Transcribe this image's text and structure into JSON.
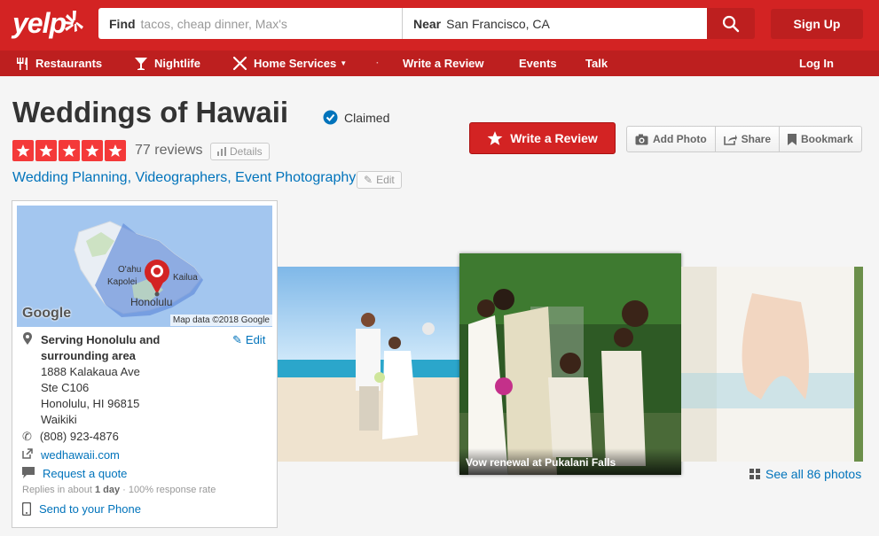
{
  "header": {
    "logo_text": "yelp",
    "find_label": "Find",
    "find_placeholder": "tacos, cheap dinner, Max's",
    "near_label": "Near",
    "near_value": "San Francisco, CA",
    "signup_label": "Sign Up",
    "brand_color": "#d32323"
  },
  "nav": {
    "items": [
      {
        "label": "Restaurants",
        "icon": "fork-knife-icon"
      },
      {
        "label": "Nightlife",
        "icon": "cocktail-icon"
      },
      {
        "label": "Home Services",
        "icon": "tools-icon"
      },
      {
        "label": "Write a Review"
      },
      {
        "label": "Events"
      },
      {
        "label": "Talk"
      }
    ],
    "login_label": "Log In"
  },
  "business": {
    "name": "Weddings of Hawaii",
    "claimed_label": "Claimed",
    "rating": 5,
    "review_count": "77 reviews",
    "details_label": "Details",
    "categories": [
      "Wedding Planning",
      "Videographers",
      "Event Photography"
    ],
    "edit_label": "Edit"
  },
  "actions": {
    "write_review": "Write a Review",
    "add_photo": "Add Photo",
    "share": "Share",
    "bookmark": "Bookmark"
  },
  "map": {
    "labels": [
      "O'ahu",
      "Kapolei",
      "Kailua",
      "Honolulu"
    ],
    "attribution": "Map data ©2018 Google",
    "google": "Google"
  },
  "info": {
    "service_area": "Serving Honolulu and surrounding area",
    "edit": "Edit",
    "address": [
      "1888 Kalakaua Ave",
      "Ste C106",
      "Honolulu, HI 96815",
      "Waikiki"
    ],
    "phone": "(808) 923-4876",
    "website": "wedhawaii.com",
    "request_quote": "Request a quote",
    "reply_prefix": "Replies in about",
    "reply_time": "1 day",
    "reply_suffix": " · 100% response rate",
    "send_phone": "Send to your Phone"
  },
  "photos": {
    "caption": "Vow renewal at Pukalani Falls",
    "see_all": "See all 86 photos"
  }
}
